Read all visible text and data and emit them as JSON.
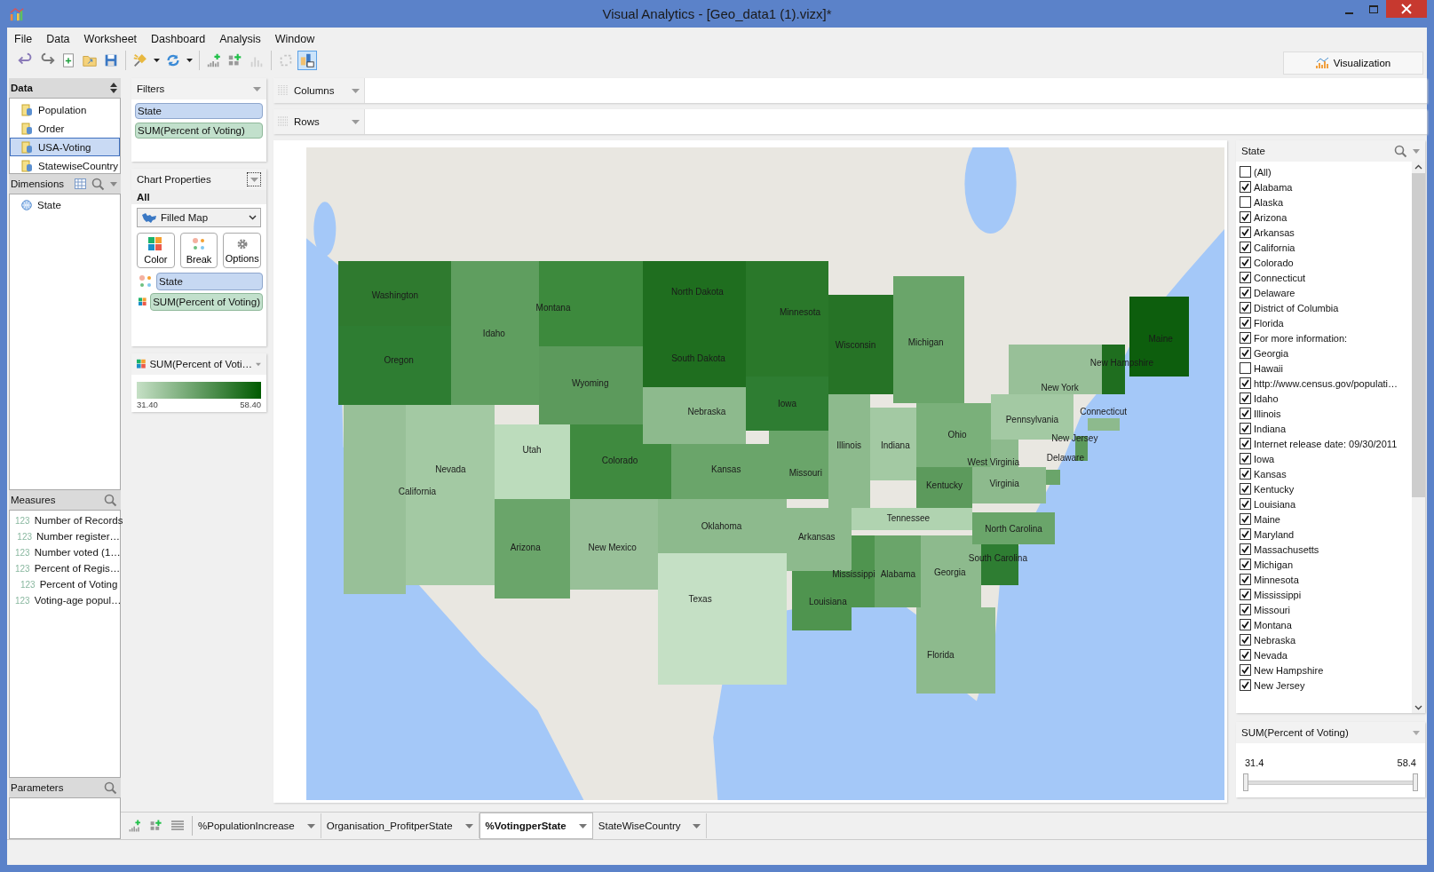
{
  "window": {
    "title": "Visual Analytics - [Geo_data1 (1).vizx]*"
  },
  "menu": [
    "File",
    "Data",
    "Worksheet",
    "Dashboard",
    "Analysis",
    "Window"
  ],
  "toolbar": [
    {
      "kind": "undo",
      "disabled": false,
      "selected": false
    },
    {
      "kind": "redo",
      "disabled": false,
      "selected": false
    },
    {
      "kind": "new",
      "disabled": false,
      "selected": false
    },
    {
      "kind": "open",
      "disabled": false,
      "selected": false
    },
    {
      "kind": "save",
      "disabled": false,
      "selected": false
    },
    {
      "kind": "connect",
      "disabled": false,
      "selected": false
    },
    {
      "kind": "refresh",
      "disabled": false,
      "selected": false
    },
    {
      "kind": "add-chart",
      "disabled": false,
      "selected": false
    },
    {
      "kind": "add-dashboard",
      "disabled": false,
      "selected": false
    },
    {
      "kind": "chart",
      "disabled": true,
      "selected": false
    },
    {
      "kind": "swap",
      "disabled": true,
      "selected": false
    },
    {
      "kind": "layout",
      "disabled": false,
      "selected": true
    }
  ],
  "visualization_button": "Visualization",
  "data_panel": {
    "title": "Data",
    "sources": [
      {
        "label": "Population",
        "selected": false
      },
      {
        "label": "Order",
        "selected": false
      },
      {
        "label": "USA-Voting",
        "selected": true
      },
      {
        "label": "StatewiseCountry",
        "selected": false
      }
    ]
  },
  "dimensions": {
    "title": "Dimensions",
    "items": [
      "State"
    ]
  },
  "measures": {
    "title": "Measures",
    "items": [
      {
        "kind": "calculated",
        "type_label": "123",
        "label": "Number of Records"
      },
      {
        "kind": "field",
        "type_label": "123",
        "label": "Number register…"
      },
      {
        "kind": "field",
        "type_label": "123",
        "label": "Number voted (1…"
      },
      {
        "kind": "field",
        "type_label": "123",
        "label": "Percent of Regis…"
      },
      {
        "kind": "field",
        "type_label": "123",
        "label": "Percent of Voting"
      },
      {
        "kind": "field",
        "type_label": "123",
        "label": "Voting-age popul…"
      }
    ]
  },
  "parameters": {
    "title": "Parameters"
  },
  "filters": {
    "title": "Filters",
    "pills": [
      {
        "kind": "dimension",
        "label": "State"
      },
      {
        "kind": "measure",
        "label": "SUM(Percent of Voting)"
      }
    ]
  },
  "chart_properties": {
    "title": "Chart Properties",
    "scope": "All",
    "chart_type": "Filled Map",
    "buttons": [
      {
        "kind": "color",
        "label": "Color"
      },
      {
        "kind": "break",
        "label": "Break"
      },
      {
        "kind": "options",
        "label": "Options"
      }
    ],
    "pills": [
      {
        "kind": "break",
        "label": "State"
      },
      {
        "kind": "color",
        "label": "SUM(Percent of Voting)"
      }
    ]
  },
  "legend": {
    "title": "SUM(Percent of Voti…",
    "min": "31.40",
    "max": "58.40"
  },
  "shelves": [
    {
      "kind": "columns",
      "label": "Columns"
    },
    {
      "kind": "rows",
      "label": "Rows"
    }
  ],
  "map_states": [
    {
      "name": "Washington",
      "color": "#2f7a2f"
    },
    {
      "name": "Oregon",
      "color": "#2e7d32"
    },
    {
      "name": "Idaho",
      "color": "#5f9e5f"
    },
    {
      "name": "Montana",
      "color": "#3d8a3d"
    },
    {
      "name": "Wyoming",
      "color": "#5c9a5c"
    },
    {
      "name": "North Dakota",
      "color": "#1f6e1f"
    },
    {
      "name": "South Dakota",
      "color": "#1f6e1f"
    },
    {
      "name": "Minnesota",
      "color": "#2a782a"
    },
    {
      "name": "Wisconsin",
      "color": "#267326"
    },
    {
      "name": "Michigan",
      "color": "#6aa56a"
    },
    {
      "name": "California",
      "color": "#98c098"
    },
    {
      "name": "Nevada",
      "color": "#a3c9a3"
    },
    {
      "name": "Utah",
      "color": "#bcdcbc"
    },
    {
      "name": "Colorado",
      "color": "#3f8a3f"
    },
    {
      "name": "Arizona",
      "color": "#6aa56a"
    },
    {
      "name": "New Mexico",
      "color": "#98c098"
    },
    {
      "name": "Nebraska",
      "color": "#8dba8d"
    },
    {
      "name": "Kansas",
      "color": "#6aa56a"
    },
    {
      "name": "Oklahoma",
      "color": "#8dba8d"
    },
    {
      "name": "Texas",
      "color": "#c5e0c5"
    },
    {
      "name": "Iowa",
      "color": "#2e7d32"
    },
    {
      "name": "Missouri",
      "color": "#6aa56a"
    },
    {
      "name": "Arkansas",
      "color": "#8dba8d"
    },
    {
      "name": "Louisiana",
      "color": "#4f944f"
    },
    {
      "name": "Mississippi",
      "color": "#4f944f"
    },
    {
      "name": "Alabama",
      "color": "#6aa56a"
    },
    {
      "name": "Georgia",
      "color": "#8dba8d"
    },
    {
      "name": "Florida",
      "color": "#8dba8d"
    },
    {
      "name": "Tennessee",
      "color": "#b0d3b0"
    },
    {
      "name": "Kentucky",
      "color": "#5c9a5c"
    },
    {
      "name": "Illinois",
      "color": "#8dba8d"
    },
    {
      "name": "Indiana",
      "color": "#a3c9a3"
    },
    {
      "name": "Ohio",
      "color": "#7ab07a"
    },
    {
      "name": "West Virginia",
      "color": "#8dba8d"
    },
    {
      "name": "Virginia",
      "color": "#8dba8d"
    },
    {
      "name": "North Carolina",
      "color": "#6aa56a"
    },
    {
      "name": "South Carolina",
      "color": "#2e7d32"
    },
    {
      "name": "Pennsylvania",
      "color": "#a3c9a3"
    },
    {
      "name": "New York",
      "color": "#98c098"
    },
    {
      "name": "New Jersey",
      "color": "#5c9a5c"
    },
    {
      "name": "Delaware",
      "color": "#6aa56a"
    },
    {
      "name": "Connecticut",
      "color": "#8dba8d"
    },
    {
      "name": "New Hampshire",
      "color": "#1f6e1f"
    },
    {
      "name": "Maine",
      "color": "#0d5e0d"
    }
  ],
  "state_filter": {
    "title": "State",
    "items": [
      {
        "label": "(All)",
        "checked": false
      },
      {
        "label": "Alabama",
        "checked": true
      },
      {
        "label": "Alaska",
        "checked": false
      },
      {
        "label": "Arizona",
        "checked": true
      },
      {
        "label": "Arkansas",
        "checked": true
      },
      {
        "label": "California",
        "checked": true
      },
      {
        "label": "Colorado",
        "checked": true
      },
      {
        "label": "Connecticut",
        "checked": true
      },
      {
        "label": "Delaware",
        "checked": true
      },
      {
        "label": "District of Columbia",
        "checked": true
      },
      {
        "label": "Florida",
        "checked": true
      },
      {
        "label": "For more information:",
        "checked": true
      },
      {
        "label": "Georgia",
        "checked": true
      },
      {
        "label": "Hawaii",
        "checked": false
      },
      {
        "label": "http://www.census.gov/populati…",
        "checked": true
      },
      {
        "label": "Idaho",
        "checked": true
      },
      {
        "label": "Illinois",
        "checked": true
      },
      {
        "label": "Indiana",
        "checked": true
      },
      {
        "label": "Internet release date: 09/30/2011",
        "checked": true
      },
      {
        "label": "Iowa",
        "checked": true
      },
      {
        "label": "Kansas",
        "checked": true
      },
      {
        "label": "Kentucky",
        "checked": true
      },
      {
        "label": "Louisiana",
        "checked": true
      },
      {
        "label": "Maine",
        "checked": true
      },
      {
        "label": "Maryland",
        "checked": true
      },
      {
        "label": "Massachusetts",
        "checked": true
      },
      {
        "label": "Michigan",
        "checked": true
      },
      {
        "label": "Minnesota",
        "checked": true
      },
      {
        "label": "Mississippi",
        "checked": true
      },
      {
        "label": "Missouri",
        "checked": true
      },
      {
        "label": "Montana",
        "checked": true
      },
      {
        "label": "Nebraska",
        "checked": true
      },
      {
        "label": "Nevada",
        "checked": true
      },
      {
        "label": "New Hampshire",
        "checked": true
      },
      {
        "label": "New Jersey",
        "checked": true
      }
    ]
  },
  "range_filter": {
    "title": "SUM(Percent of Voting)",
    "min": "31.4",
    "max": "58.4",
    "handles": [
      {
        "level": 0
      },
      {
        "level": 1
      }
    ]
  },
  "sheet_tabs": [
    {
      "label": "%PopulationIncrease",
      "selected": false
    },
    {
      "label": "Organisation_ProfitperState",
      "selected": false
    },
    {
      "label": "%VotingperState",
      "selected": true
    },
    {
      "label": "StateWiseCountry",
      "selected": false
    }
  ]
}
